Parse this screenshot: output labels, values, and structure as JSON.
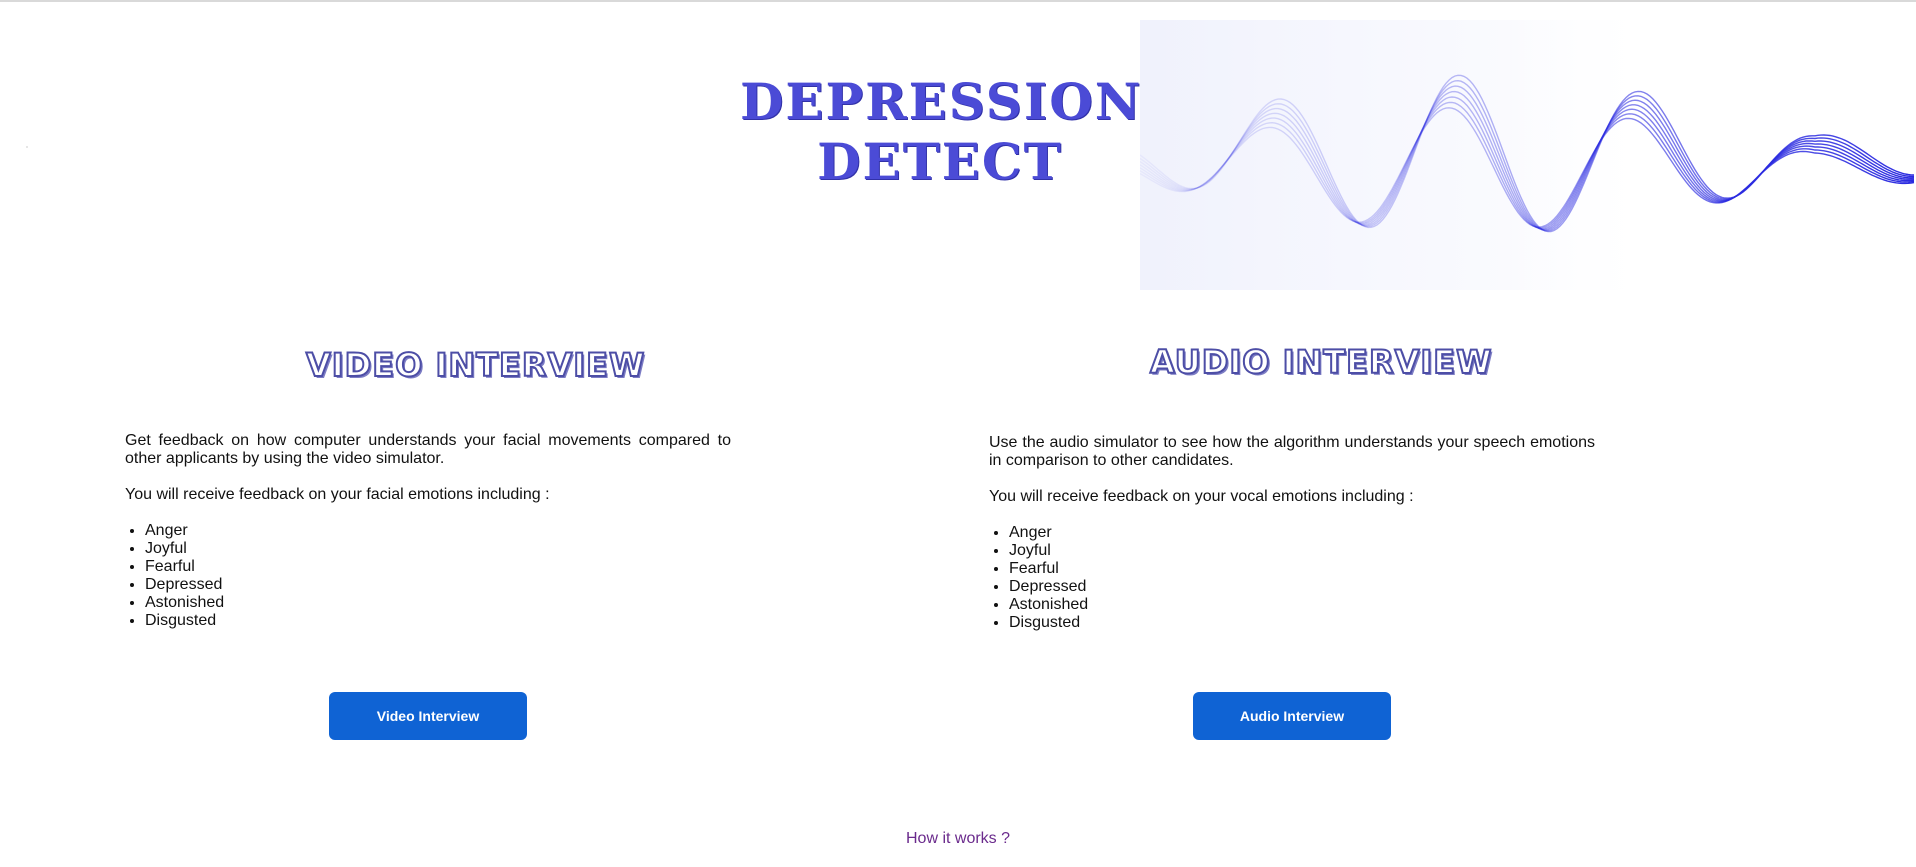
{
  "header": {
    "logo_line1": "DEPRESSION",
    "logo_line2": "DETECT"
  },
  "video_section": {
    "title": "VIDEO INTERVIEW",
    "lead": "Get feedback on how computer understands your facial movements compared to other applicants by using the video simulator.",
    "sub": "You will receive feedback on your facial emotions including :",
    "emotions": [
      "Anger",
      "Joyful",
      "Fearful",
      "Depressed",
      "Astonished",
      "Disgusted"
    ],
    "button_label": "Video Interview"
  },
  "audio_section": {
    "title": "AUDIO INTERVIEW",
    "lead": "Use the audio simulator to see how the algorithm understands your speech emotions in comparison to other candidates.",
    "sub": "You will receive feedback on your vocal emotions including :",
    "emotions": [
      "Anger",
      "Joyful",
      "Fearful",
      "Depressed",
      "Astonished",
      "Disgusted"
    ],
    "button_label": "Audio Interview"
  },
  "footer": {
    "how_link": "How it works ?"
  },
  "colors": {
    "logo": "#4b4bd6",
    "button": "#0f63d4",
    "link": "#6a2a8c",
    "wave": "#2a2ae0"
  },
  "icons": {
    "wave": "sound-wave-icon"
  }
}
